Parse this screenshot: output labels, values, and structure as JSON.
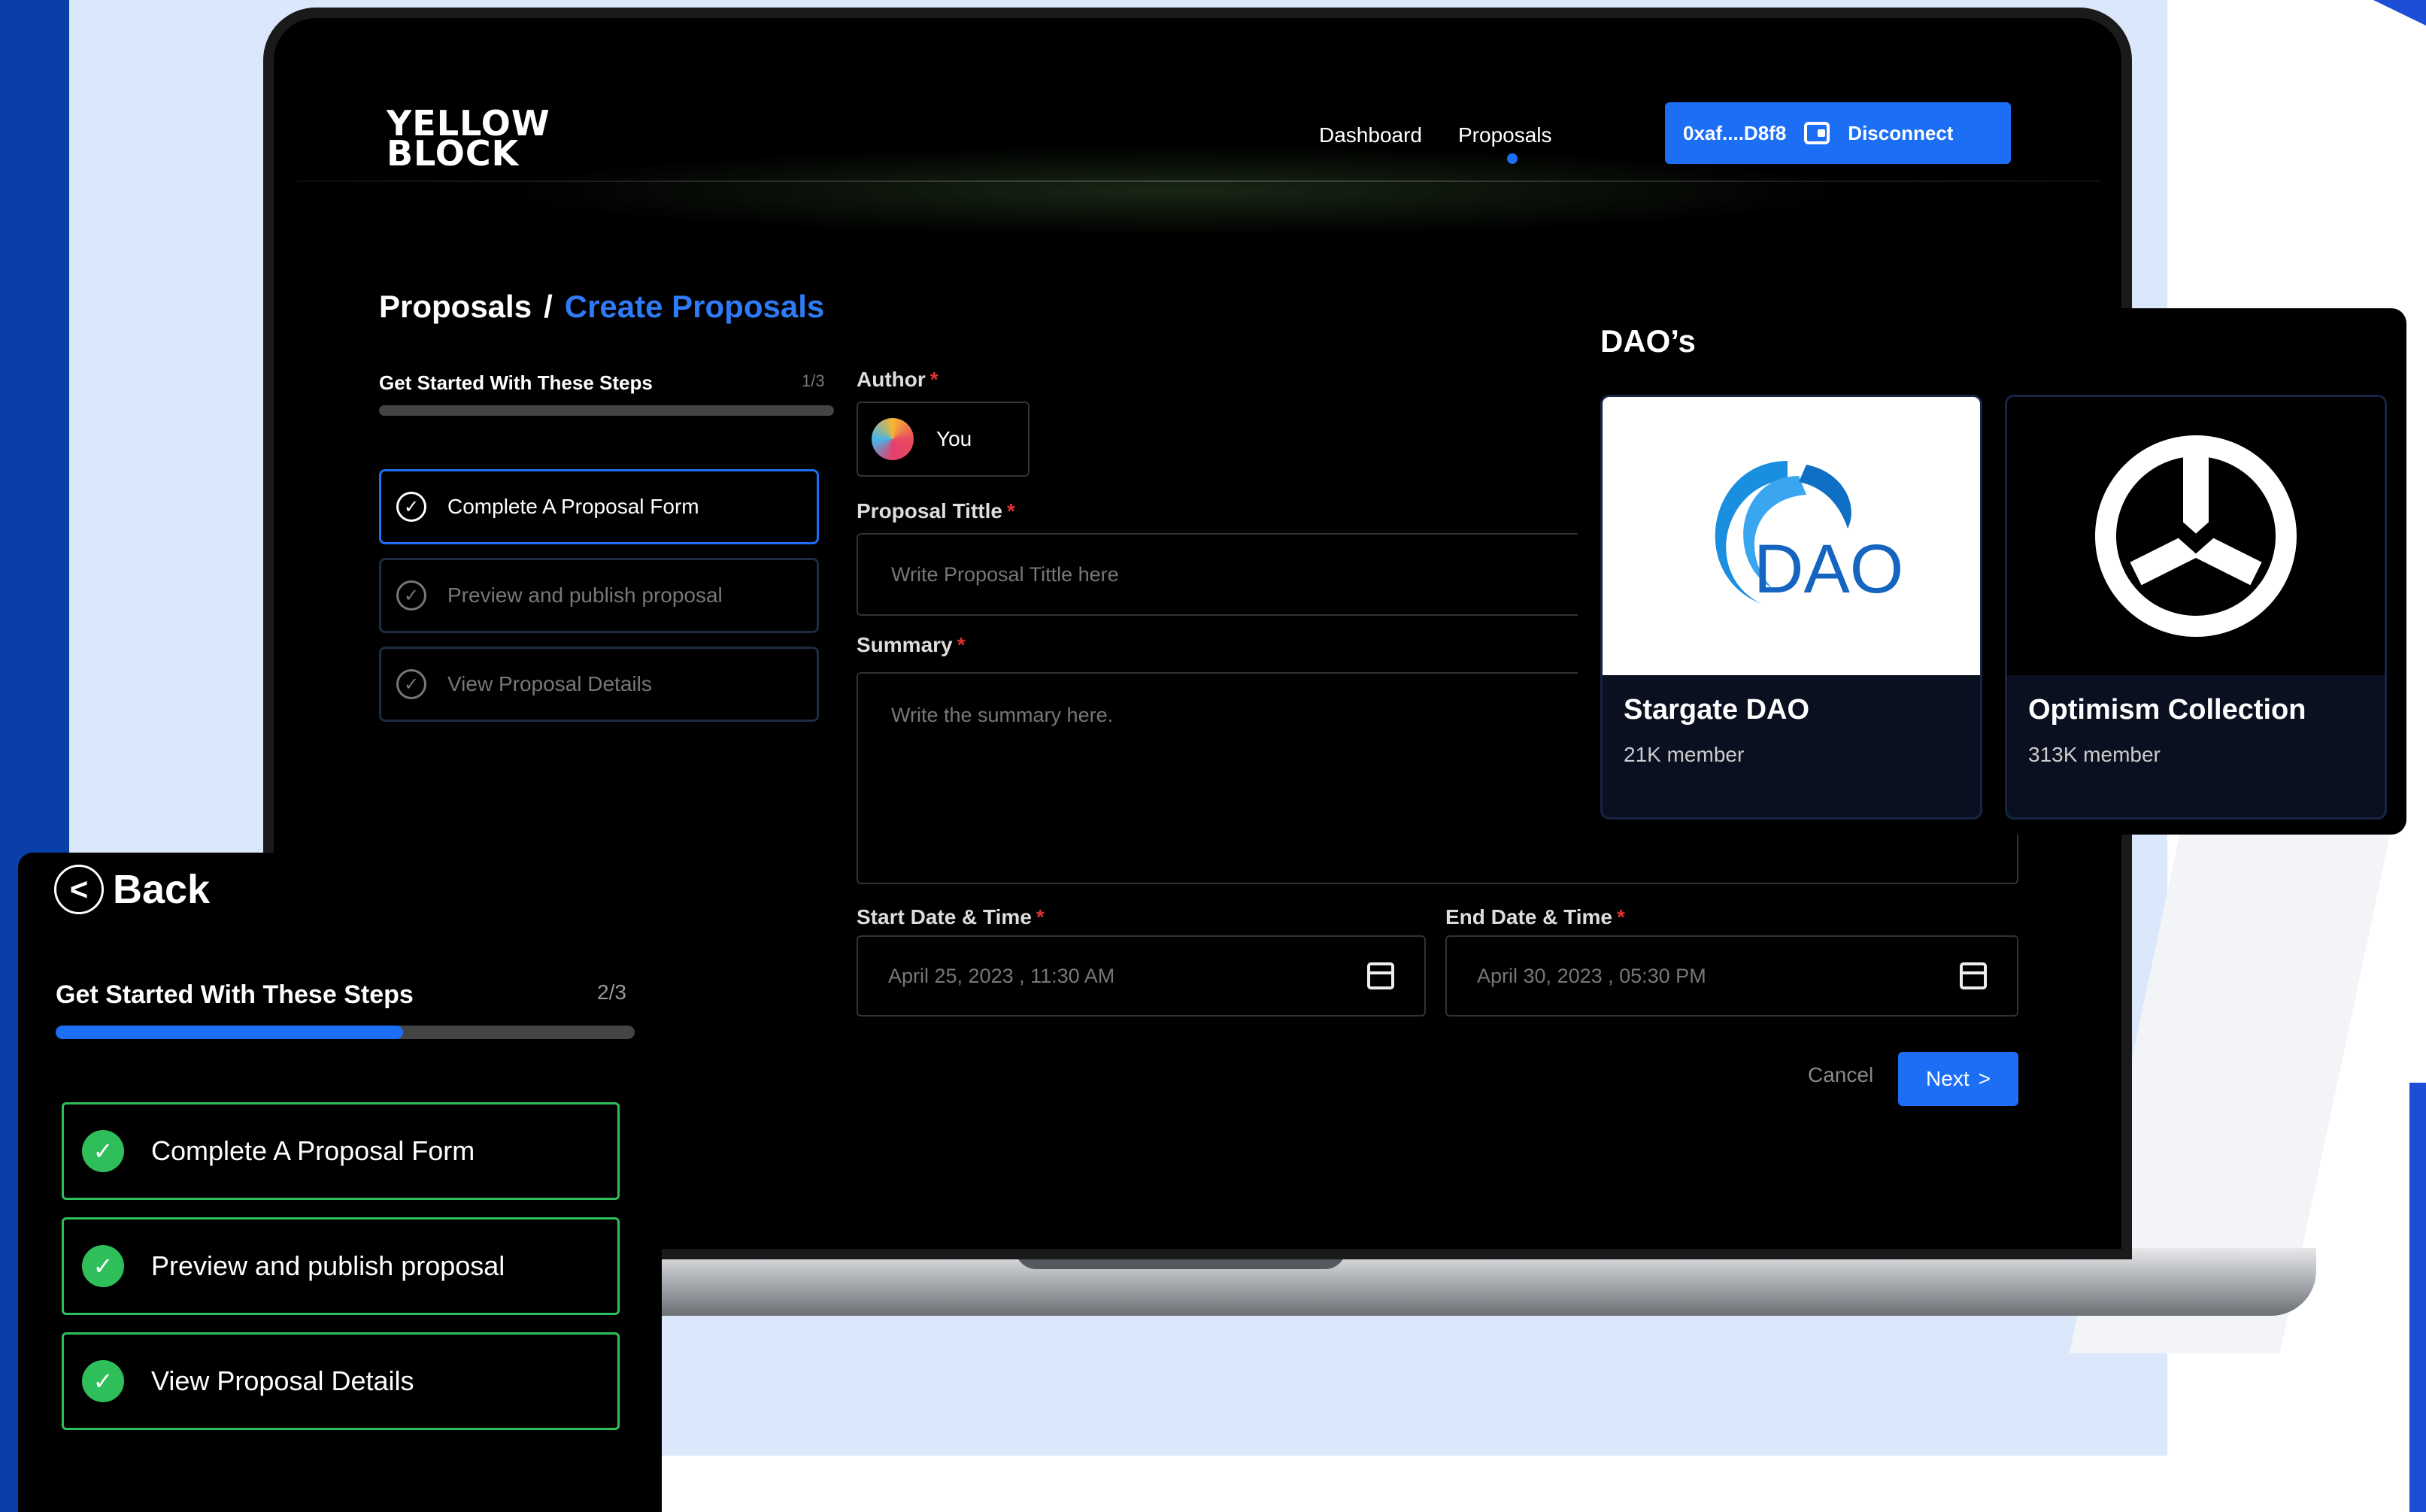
{
  "laptop": {
    "logo_line1": "YELLOW",
    "logo_line2": "BLOCK",
    "nav": {
      "dashboard": "Dashboard",
      "proposals": "Proposals"
    },
    "wallet": {
      "address": "0xaf....D8f8",
      "disconnect_label": "Disconnect",
      "icon": "wallet-icon"
    },
    "breadcrumb": {
      "root": "Proposals",
      "separator": "/",
      "current": "Create Proposals"
    },
    "steps": {
      "title": "Get Started With These Steps",
      "count": "1/3",
      "progress_fraction": 0.0,
      "items": [
        {
          "label": "Complete A Proposal Form",
          "active": true
        },
        {
          "label": "Preview and publish proposal",
          "active": false
        },
        {
          "label": "View Proposal Details",
          "active": false
        }
      ]
    },
    "form": {
      "author_label": "Author",
      "author_value": "You",
      "title_label": "Proposal Tittle",
      "title_placeholder": "Write Proposal Tittle here",
      "summary_label": "Summary",
      "summary_placeholder": "Write the summary here.",
      "start_label": "Start Date & Time",
      "start_value": "April 25, 2023 , 11:30 AM",
      "end_label": "End Date & Time",
      "end_value": "April 30, 2023 , 05:30 PM",
      "required_mark": "*",
      "cancel_label": "Cancel",
      "next_label": "Next",
      "next_arrow": ">"
    }
  },
  "daos": {
    "title": "DAO’s",
    "cards": [
      {
        "name": "Stargate DAO",
        "members": "21K member",
        "logo_text": "DAO"
      },
      {
        "name": "Optimism Collection",
        "members": "313K member"
      }
    ]
  },
  "back_panel": {
    "back_label": "Back",
    "back_icon": "<",
    "steps_title": "Get Started With These Steps",
    "steps_count": "2/3",
    "progress_fraction": 0.6,
    "items": [
      {
        "label": "Complete A Proposal Form"
      },
      {
        "label": "Preview and publish proposal"
      },
      {
        "label": "View Proposal Details"
      }
    ],
    "check_glyph": "✓"
  },
  "colors": {
    "accent": "#1c6ef5",
    "success": "#2fbf5a",
    "required": "#e03131",
    "background_light": "#dbe7fb",
    "brand_dark_blue": "#0a3ea8"
  }
}
